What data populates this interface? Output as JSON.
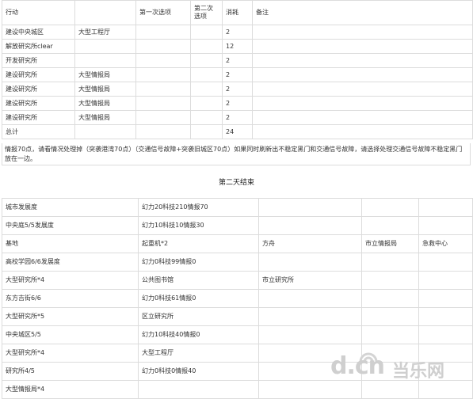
{
  "action_table": {
    "headers": [
      "行动",
      "",
      "第一次选项",
      "第二次选项",
      "消耗",
      "备注"
    ],
    "rows": [
      [
        "建设中央城区",
        "大型工程厅",
        "",
        "",
        "2",
        ""
      ],
      [
        "解放研究所clear",
        "",
        "",
        "",
        "12",
        ""
      ],
      [
        "开发研究所",
        "",
        "",
        "",
        "2",
        ""
      ],
      [
        "建设研究所",
        "大型情报局",
        "",
        "",
        "2",
        ""
      ],
      [
        "建设研究所",
        "大型情报局",
        "",
        "",
        "2",
        ""
      ],
      [
        "建设研究所",
        "大型情报局",
        "",
        "",
        "2",
        ""
      ],
      [
        "建设研究所",
        "大型情报局",
        "",
        "",
        "2",
        ""
      ],
      [
        "总计",
        "",
        "",
        "",
        "24",
        ""
      ]
    ],
    "note": "情报70点，请看情况处理掉（突袭港湾70点）（交通信号故障+突袭旧城区70点）如果同时刷新出不稳定黑门和交通信号故障，请选择处理交通信号故障不稳定黑门放在一边。"
  },
  "section_title": "第二天结束",
  "status_table": {
    "rows": [
      [
        "城市发展度",
        "幻力20科技210情报70",
        "",
        "",
        ""
      ],
      [
        "中央庭5/5发展度",
        "幻力10科技10情报30",
        "",
        "",
        ""
      ],
      [
        "基地",
        "起重机*2",
        "方舟",
        "市立情报局",
        "急救中心"
      ],
      [
        "高校学园6/6发展度",
        "幻力0科技99情报0",
        "",
        "",
        ""
      ],
      [
        "大型研究所*4",
        "公共图书馆",
        "市立研究所",
        "",
        ""
      ],
      [
        "东方吉街6/6",
        "幻力0科技61情报0",
        "",
        "",
        ""
      ],
      [
        "大型研究所*5",
        "区立研究所",
        "",
        "",
        ""
      ],
      [
        "中央城区5/5",
        "幻力10科技40情报0",
        "",
        "",
        ""
      ],
      [
        "大型研究所*4",
        "大型工程厅",
        "",
        "",
        ""
      ],
      [
        "研究所4/5",
        "幻力0科技0情报40",
        "",
        "",
        ""
      ],
      [
        "大型情报局*4",
        "",
        "",
        "",
        ""
      ]
    ]
  },
  "watermark": {
    "text": "d.cn",
    "brand": "当乐网"
  }
}
